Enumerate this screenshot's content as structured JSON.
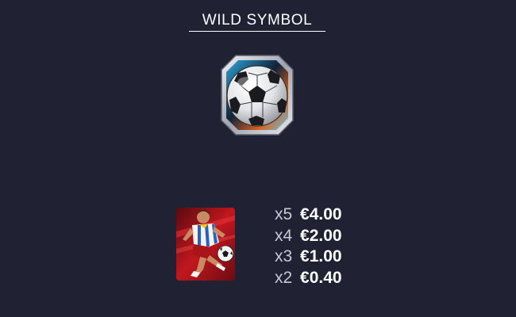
{
  "title": "WILD SYMBOL",
  "wild_symbol": {
    "icon": "soccer-ball-icon",
    "frame_color": "#c9ccd6",
    "accent_colors": [
      "#3fb7e6",
      "#e46a1f"
    ]
  },
  "player_symbol": {
    "icon": "soccer-player-icon",
    "background_color": "#b3161c"
  },
  "paytable": [
    {
      "multiplier": "x5",
      "amount": "€4.00"
    },
    {
      "multiplier": "x4",
      "amount": "€2.00"
    },
    {
      "multiplier": "x3",
      "amount": "€1.00"
    },
    {
      "multiplier": "x2",
      "amount": "€0.40"
    }
  ]
}
